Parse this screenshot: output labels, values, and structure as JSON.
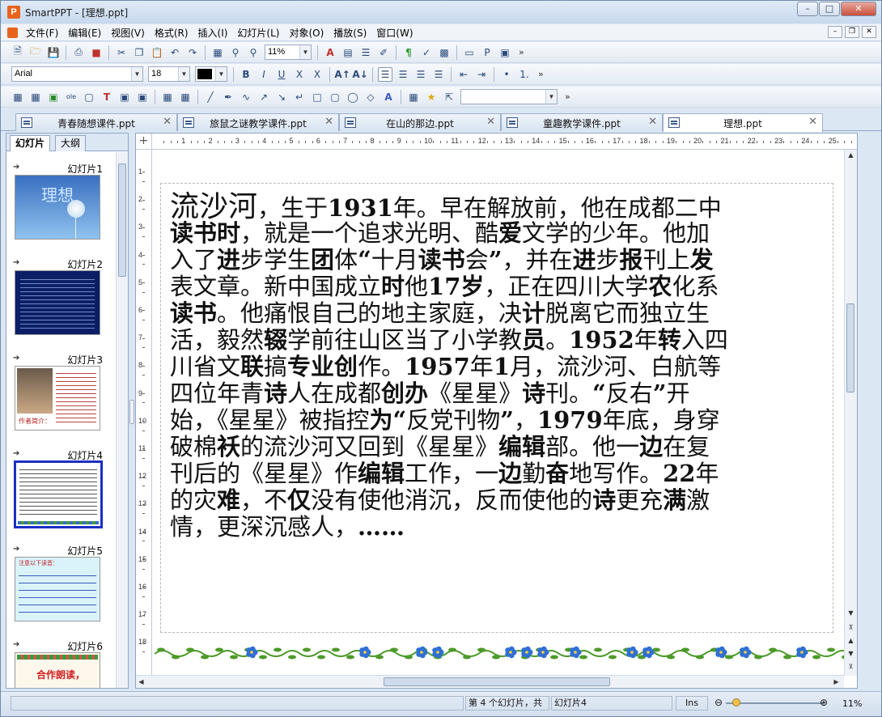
{
  "window": {
    "title": "SmartPPT - [理想.ppt]",
    "app_icon_letter": "P"
  },
  "menubar": {
    "items": [
      "文件(F)",
      "编辑(E)",
      "视图(V)",
      "格式(R)",
      "插入(I)",
      "幻灯片(L)",
      "对象(O)",
      "播放(S)",
      "窗口(W)"
    ]
  },
  "toolbar": {
    "zoom_value": "11%",
    "font_name": "Arial",
    "font_size": "18",
    "more_glyph": "»"
  },
  "doc_tabs": [
    {
      "label": "青春随想课件.ppt",
      "active": false
    },
    {
      "label": "旅鼠之谜教学课件.ppt",
      "active": false
    },
    {
      "label": "在山的那边.ppt",
      "active": false
    },
    {
      "label": "童趣教学课件.ppt",
      "active": false
    },
    {
      "label": "理想.ppt",
      "active": true
    }
  ],
  "left_panel": {
    "tab_slides": "幻灯片",
    "tab_outline": "大纲",
    "slides": [
      {
        "label": "幻灯片1",
        "title": "理想",
        "selected": false
      },
      {
        "label": "幻灯片2",
        "selected": false
      },
      {
        "label": "幻灯片3",
        "caption": "作者简介：",
        "selected": false
      },
      {
        "label": "幻灯片4",
        "selected": true
      },
      {
        "label": "幻灯片5",
        "heading": "注意以下读音：",
        "selected": false
      },
      {
        "label": "幻灯片6",
        "title": "合作朗读，",
        "selected": false
      }
    ]
  },
  "slide": {
    "lines": [
      [
        [
          "流沙河",
          "n",
          "big"
        ],
        [
          "，生于",
          "n"
        ],
        [
          "1931",
          "b"
        ],
        [
          "年。早在解放前，他在成都二中",
          "n"
        ]
      ],
      [
        [
          "读书时",
          "b"
        ],
        [
          "，就是一个追求光明、酷",
          "n"
        ],
        [
          "爱",
          "b"
        ],
        [
          "文学的少年。他加",
          "n"
        ]
      ],
      [
        [
          "入了",
          "n"
        ],
        [
          "进",
          "b"
        ],
        [
          "步学生",
          "n"
        ],
        [
          "团",
          "b"
        ],
        [
          "体",
          "n"
        ],
        [
          "“",
          "b"
        ],
        [
          "十月",
          "n"
        ],
        [
          "读书",
          "b"
        ],
        [
          "会",
          "n"
        ],
        [
          "”",
          "b"
        ],
        [
          "，并在",
          "n"
        ],
        [
          "进",
          "b"
        ],
        [
          "步",
          "n"
        ],
        [
          "报",
          "b"
        ],
        [
          "刊上",
          "n"
        ],
        [
          "发",
          "b"
        ]
      ],
      [
        [
          "表文章。新中国成立",
          "n"
        ],
        [
          "时",
          "b"
        ],
        [
          "他",
          "n"
        ],
        [
          "17岁",
          "b"
        ],
        [
          "，正在四川大学",
          "n"
        ],
        [
          "农",
          "b"
        ],
        [
          "化系",
          "n"
        ]
      ],
      [
        [
          "读书",
          "b"
        ],
        [
          "。他痛恨自己的地主家庭，决",
          "n"
        ],
        [
          "计",
          "b"
        ],
        [
          "脱离它而独立生",
          "n"
        ]
      ],
      [
        [
          "活，毅然",
          "n"
        ],
        [
          "辍",
          "b"
        ],
        [
          "学前往山区当了小学教",
          "n"
        ],
        [
          "员",
          "b"
        ],
        [
          "。",
          "n"
        ],
        [
          "1952",
          "b"
        ],
        [
          "年",
          "n"
        ],
        [
          "转",
          "b"
        ],
        [
          "入四",
          "n"
        ]
      ],
      [
        [
          "川省文",
          "n"
        ],
        [
          "联",
          "b"
        ],
        [
          "搞",
          "n"
        ],
        [
          "专业创",
          "b"
        ],
        [
          "作。",
          "n"
        ],
        [
          "1957",
          "b"
        ],
        [
          "年",
          "n"
        ],
        [
          "1",
          "b"
        ],
        [
          "月，流沙河、白航等",
          "n"
        ]
      ],
      [
        [
          "四位年青",
          "n"
        ],
        [
          "诗",
          "b"
        ],
        [
          "人在成都",
          "n"
        ],
        [
          "创办",
          "b"
        ],
        [
          "《星星》",
          "n"
        ],
        [
          "诗",
          "b"
        ],
        [
          "刊。",
          "n"
        ],
        [
          "“",
          "b"
        ],
        [
          "反右",
          "n"
        ],
        [
          "”",
          "b"
        ],
        [
          "开",
          "n"
        ]
      ],
      [
        [
          "始，《星星》被指控",
          "n"
        ],
        [
          "为“",
          "b"
        ],
        [
          "反党刊物",
          "n"
        ],
        [
          "”",
          "b"
        ],
        [
          "，",
          "n"
        ],
        [
          "1979",
          "b"
        ],
        [
          "年底，身穿",
          "n"
        ]
      ],
      [
        [
          "破棉",
          "n"
        ],
        [
          "袄",
          "b"
        ],
        [
          "的流沙河又回到《星星》",
          "n"
        ],
        [
          "编辑",
          "b"
        ],
        [
          "部。他一",
          "n"
        ],
        [
          "边",
          "b"
        ],
        [
          "在复",
          "n"
        ]
      ],
      [
        [
          "刊后的《星星》作",
          "n"
        ],
        [
          "编辑",
          "b"
        ],
        [
          "工作，一",
          "n"
        ],
        [
          "边",
          "b"
        ],
        [
          "勤",
          "n"
        ],
        [
          "奋",
          "b"
        ],
        [
          "地写作。",
          "n"
        ],
        [
          "22",
          "b"
        ],
        [
          "年",
          "n"
        ]
      ],
      [
        [
          "的灾",
          "n"
        ],
        [
          "难",
          "b"
        ],
        [
          "，不",
          "n"
        ],
        [
          "仅",
          "b"
        ],
        [
          "没有使他消沉，反而使他的",
          "n"
        ],
        [
          "诗",
          "b"
        ],
        [
          "更充",
          "n"
        ],
        [
          "满",
          "b"
        ],
        [
          "激",
          "n"
        ]
      ],
      [
        [
          "情，更深沉感人，",
          "n"
        ],
        [
          "……",
          "b"
        ]
      ]
    ]
  },
  "ruler": {
    "h_ticks": [
      "1",
      "2",
      "3",
      "4",
      "5",
      "6",
      "7",
      "8",
      "9",
      "10",
      "11",
      "12",
      "13",
      "14",
      "15",
      "16",
      "17",
      "18",
      "19",
      "20",
      "21",
      "22",
      "23",
      "24",
      "25"
    ],
    "v_ticks": [
      "1",
      "2",
      "3",
      "4",
      "5",
      "6",
      "7",
      "8",
      "9",
      "10",
      "11",
      "12",
      "13",
      "14",
      "15",
      "16",
      "17",
      "18"
    ]
  },
  "statusbar": {
    "slide_pos": "第 4 个幻灯片，共",
    "slide_name": "幻灯片4",
    "mode": "Ins",
    "zoom": "11%"
  },
  "colors": {
    "selection": "#1b2fc2",
    "app_orange": "#e8631c",
    "flower_blue": "#2f6fd6",
    "leaf_green": "#4d9a2a"
  }
}
